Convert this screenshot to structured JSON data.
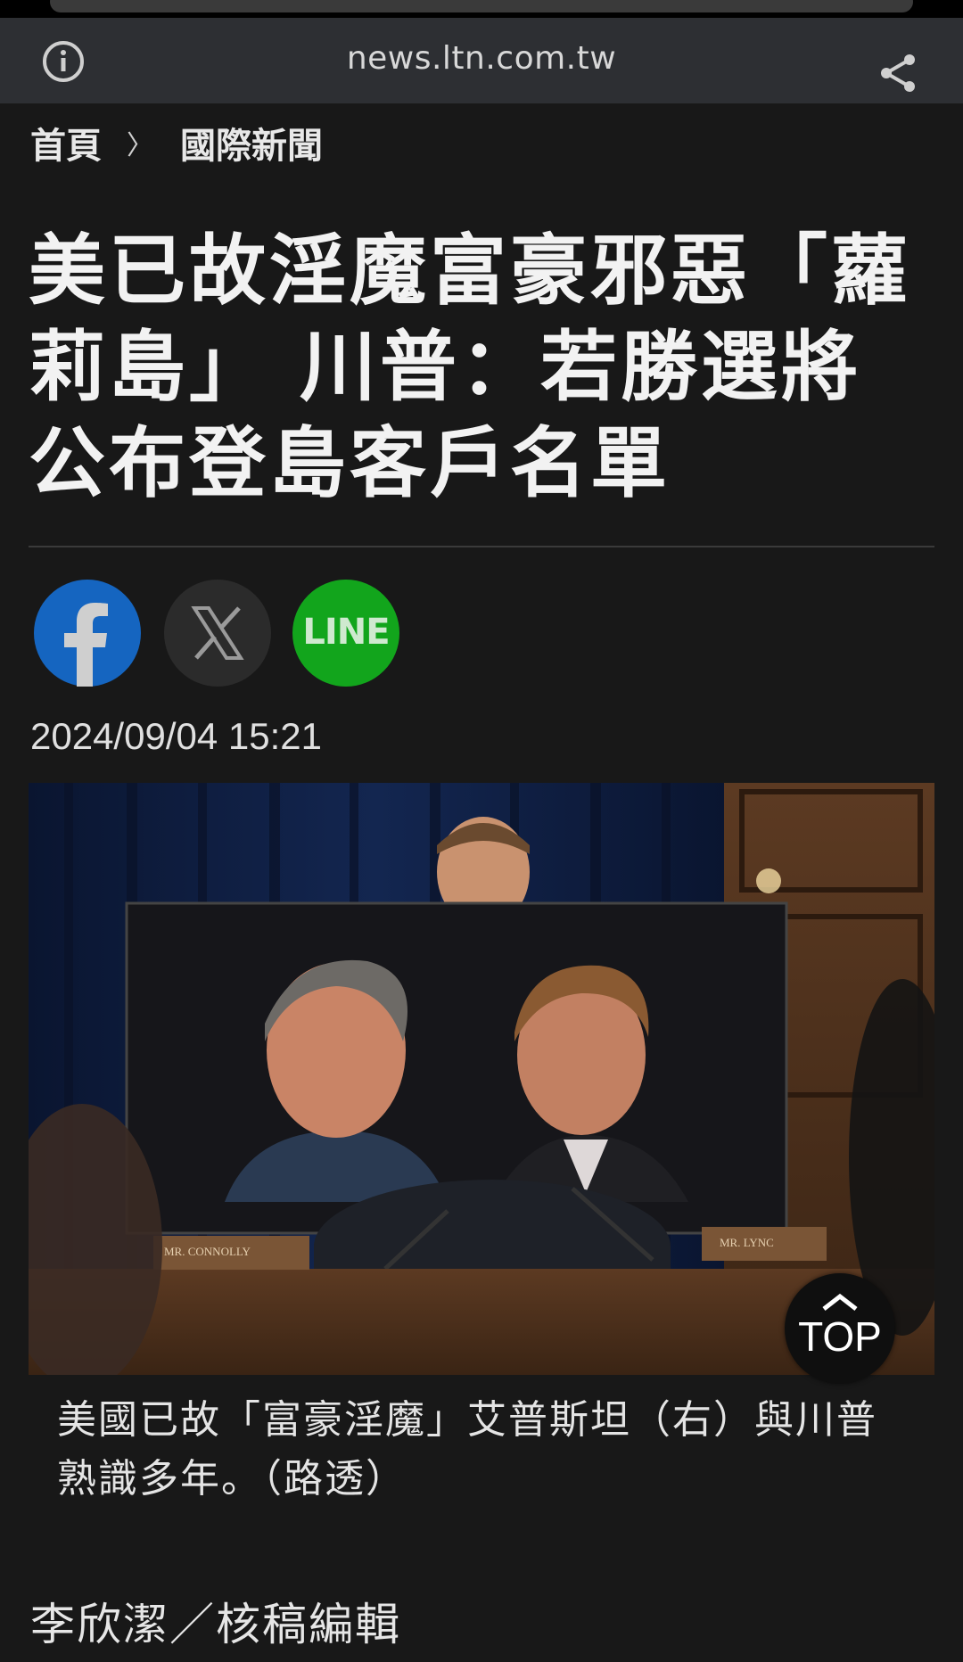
{
  "browser": {
    "url": "news.ltn.com.tw",
    "info_icon": "info-icon",
    "share_icon": "share-icon"
  },
  "breadcrumb": {
    "home": "首頁",
    "separator": "〉",
    "section": "國際新聞"
  },
  "article": {
    "headline": "美已故淫魔富豪邪惡「蘿莉島」 川普：若勝選將公布登島客戶名單",
    "timestamp": "2024/09/04 15:21",
    "photo_caption": "美國已故「富豪淫魔」艾普斯坦（右）與川普熟識多年。（路透）",
    "byline": "李欣潔／核稿編輯",
    "photo_labels": {
      "nameplate_left": "MR. CONNOLLY",
      "nameplate_right": "MR. LYNC"
    }
  },
  "share": {
    "facebook_icon": "facebook-icon",
    "x_icon": "x-icon",
    "line_label": "LINE"
  },
  "top_button": {
    "label": "TOP"
  },
  "colors": {
    "page_bg": "#181818",
    "urlbar_bg": "#2d2f33",
    "facebook": "#1565c0",
    "x_bg": "#2b2b2b",
    "line": "#12a51c"
  }
}
